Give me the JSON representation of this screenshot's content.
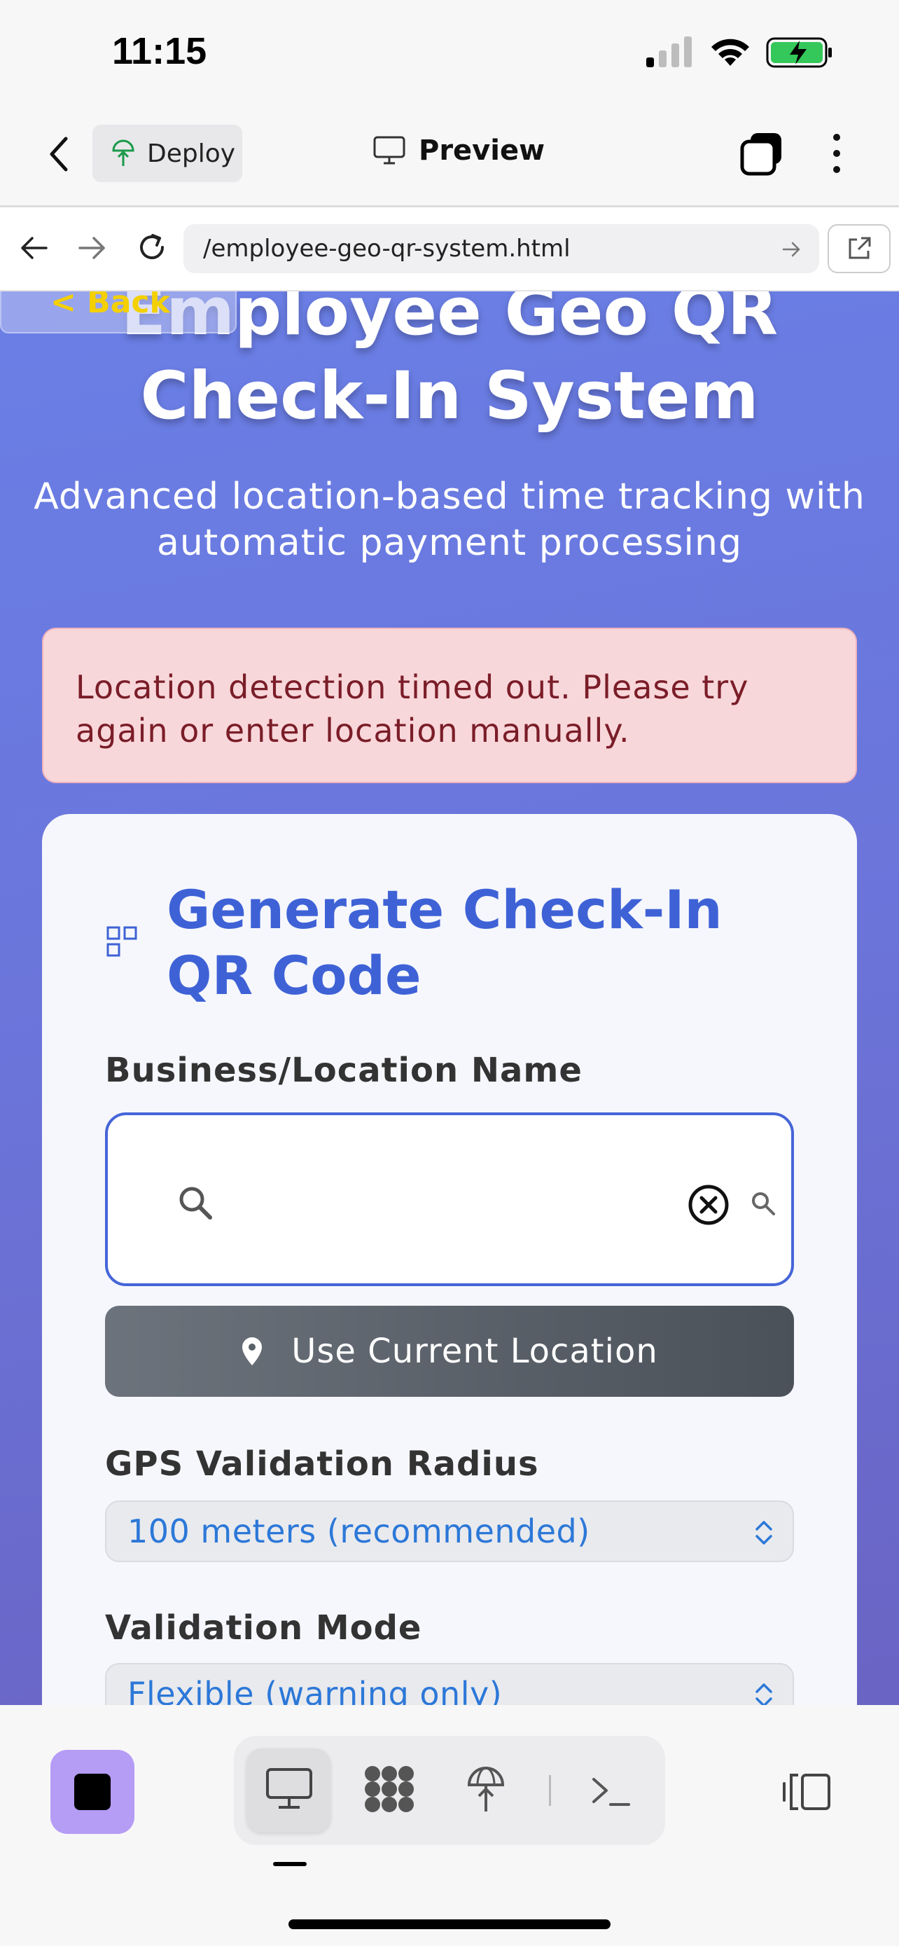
{
  "status_bar": {
    "time": "11:15"
  },
  "app_header": {
    "deploy_label": "Deploy",
    "preview_label": "Preview"
  },
  "browser": {
    "url": "/employee-geo-qr-system.html"
  },
  "page": {
    "back_link": "< Back",
    "title": "Employee Geo QR Check-In System",
    "subtitle": "Advanced location-based time tracking with automatic payment processing",
    "alert": "Location detection timed out. Please try again or enter location manually."
  },
  "card": {
    "title": "Generate Check-In QR Code",
    "business_label": "Business/Location Name",
    "search_value": "",
    "search_placeholder": "",
    "use_location_label": "Use Current Location",
    "radius_label": "GPS Validation Radius",
    "radius_value": "100 meters (recommended)",
    "mode_label": "Validation Mode",
    "mode_value": "Flexible (warning only)"
  },
  "colors": {
    "accent": "#3e62d6",
    "gradient_start": "#6a7fe6",
    "gradient_end": "#6a64c4",
    "alert_bg": "#f8d7da",
    "alert_text": "#7a1d28",
    "stop_button": "#b59cf5",
    "select_text": "#2c78d8"
  },
  "icons": {
    "signal": "cellular-signal-icon",
    "wifi": "wifi-icon",
    "battery": "battery-charging-icon",
    "qr": "qr-code-icon",
    "search": "search-icon",
    "clear": "clear-circle-icon",
    "location": "map-pin-icon"
  }
}
